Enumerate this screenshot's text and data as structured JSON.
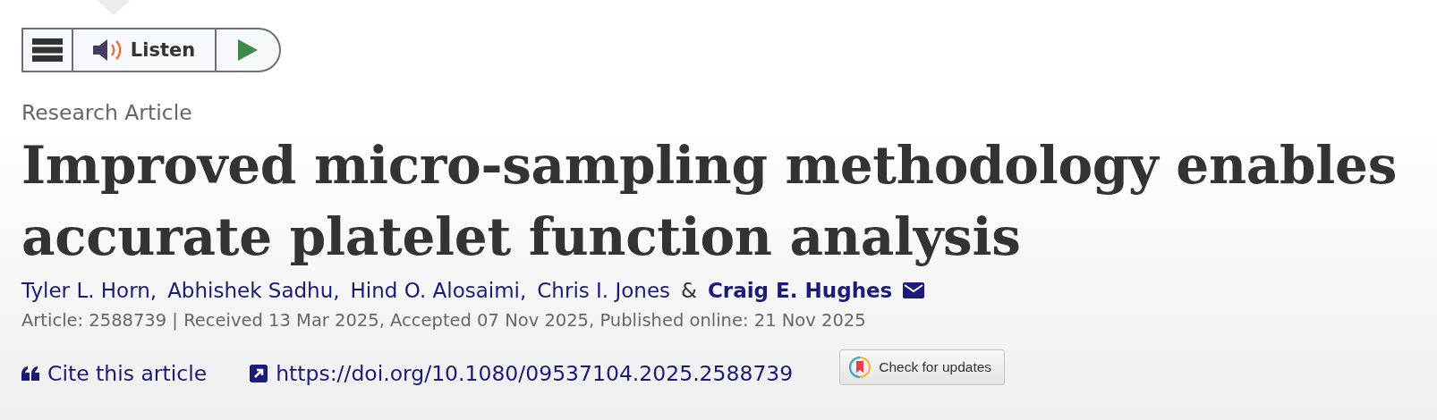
{
  "listen_bar": {
    "label": "Listen"
  },
  "article_type": "Research Article",
  "title_lines": [
    "Improved micro-sampling methodology enables",
    "accurate platelet function analysis"
  ],
  "authors": [
    {
      "name": "Tyler L. Horn,",
      "corresponding": false
    },
    {
      "name": "Abhishek Sadhu,",
      "corresponding": false
    },
    {
      "name": "Hind O. Alosaimi,",
      "corresponding": false
    },
    {
      "name": "Chris I. Jones",
      "corresponding": false
    },
    {
      "name": "&",
      "kind": "conjunction"
    },
    {
      "name": "Craig E. Hughes",
      "corresponding": true
    }
  ],
  "meta": "Article: 2588739 | Received 13 Mar 2025, Accepted 07 Nov 2025, Published online: 21 Nov 2025",
  "links": [
    {
      "kind": "cite",
      "label": "Cite this article"
    },
    {
      "kind": "doi",
      "label": "https://doi.org/10.1080/09537104.2025.2588739"
    }
  ],
  "updates_button": {
    "label": "Check for updates"
  }
}
